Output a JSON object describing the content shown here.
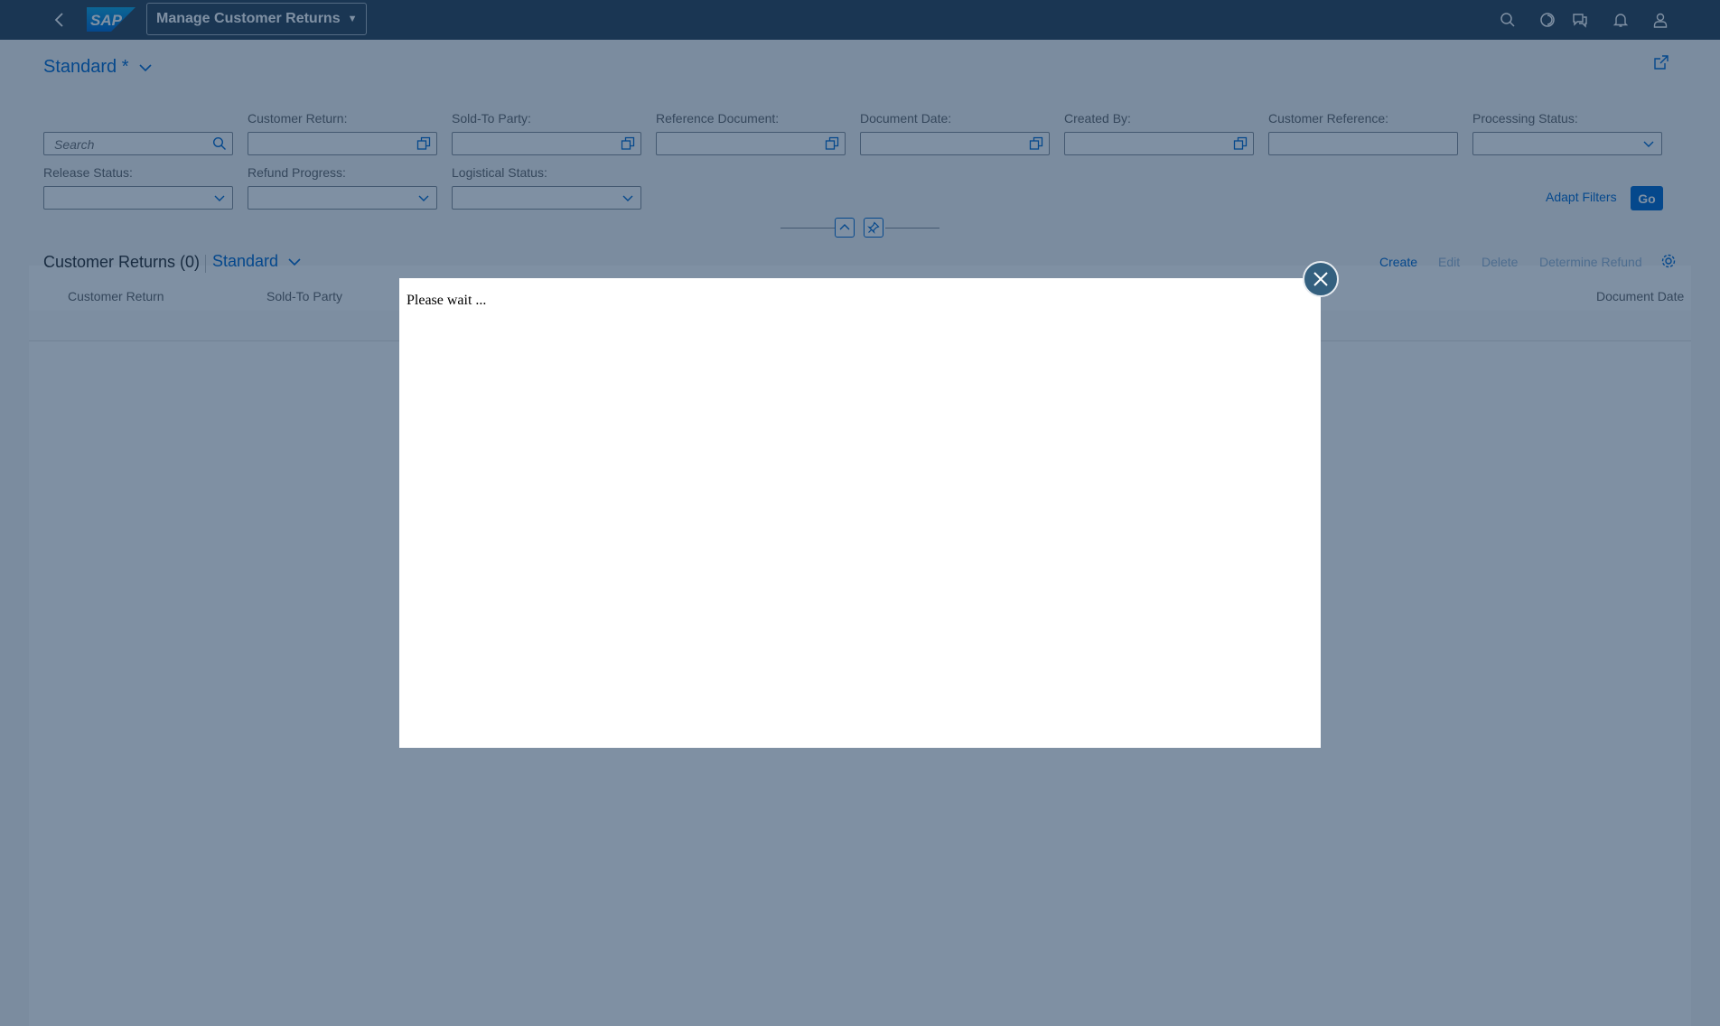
{
  "shell": {
    "app_title": "Manage Customer Returns",
    "logo_text": "SAP",
    "icons": [
      "back-icon",
      "search-icon",
      "copilot-icon",
      "feedback-icon",
      "notifications-icon",
      "user-icon"
    ]
  },
  "variant": {
    "title": "Standard *"
  },
  "filters": {
    "search_placeholder": "Search",
    "fields": [
      {
        "label": "Customer Return:"
      },
      {
        "label": "Sold-To Party:"
      },
      {
        "label": "Reference Document:"
      },
      {
        "label": "Document Date:"
      },
      {
        "label": "Created By:"
      },
      {
        "label": "Customer Reference:"
      },
      {
        "label": "Processing Status:"
      },
      {
        "label": "Release Status:"
      },
      {
        "label": "Refund Progress:"
      },
      {
        "label": "Logistical Status:"
      }
    ],
    "adapt_filters_label": "Adapt Filters",
    "go_label": "Go"
  },
  "table": {
    "title": "Customer Returns (0)",
    "variant": "Standard",
    "actions": {
      "create": "Create",
      "edit": "Edit",
      "delete": "Delete",
      "determine_refund": "Determine Refund"
    },
    "columns": [
      "Customer Return",
      "Sold-To Party",
      "Document Date"
    ]
  },
  "dialog": {
    "message": "Please wait ..."
  },
  "colors": {
    "shell": "#354a5f",
    "accent": "#0a6ed1"
  }
}
